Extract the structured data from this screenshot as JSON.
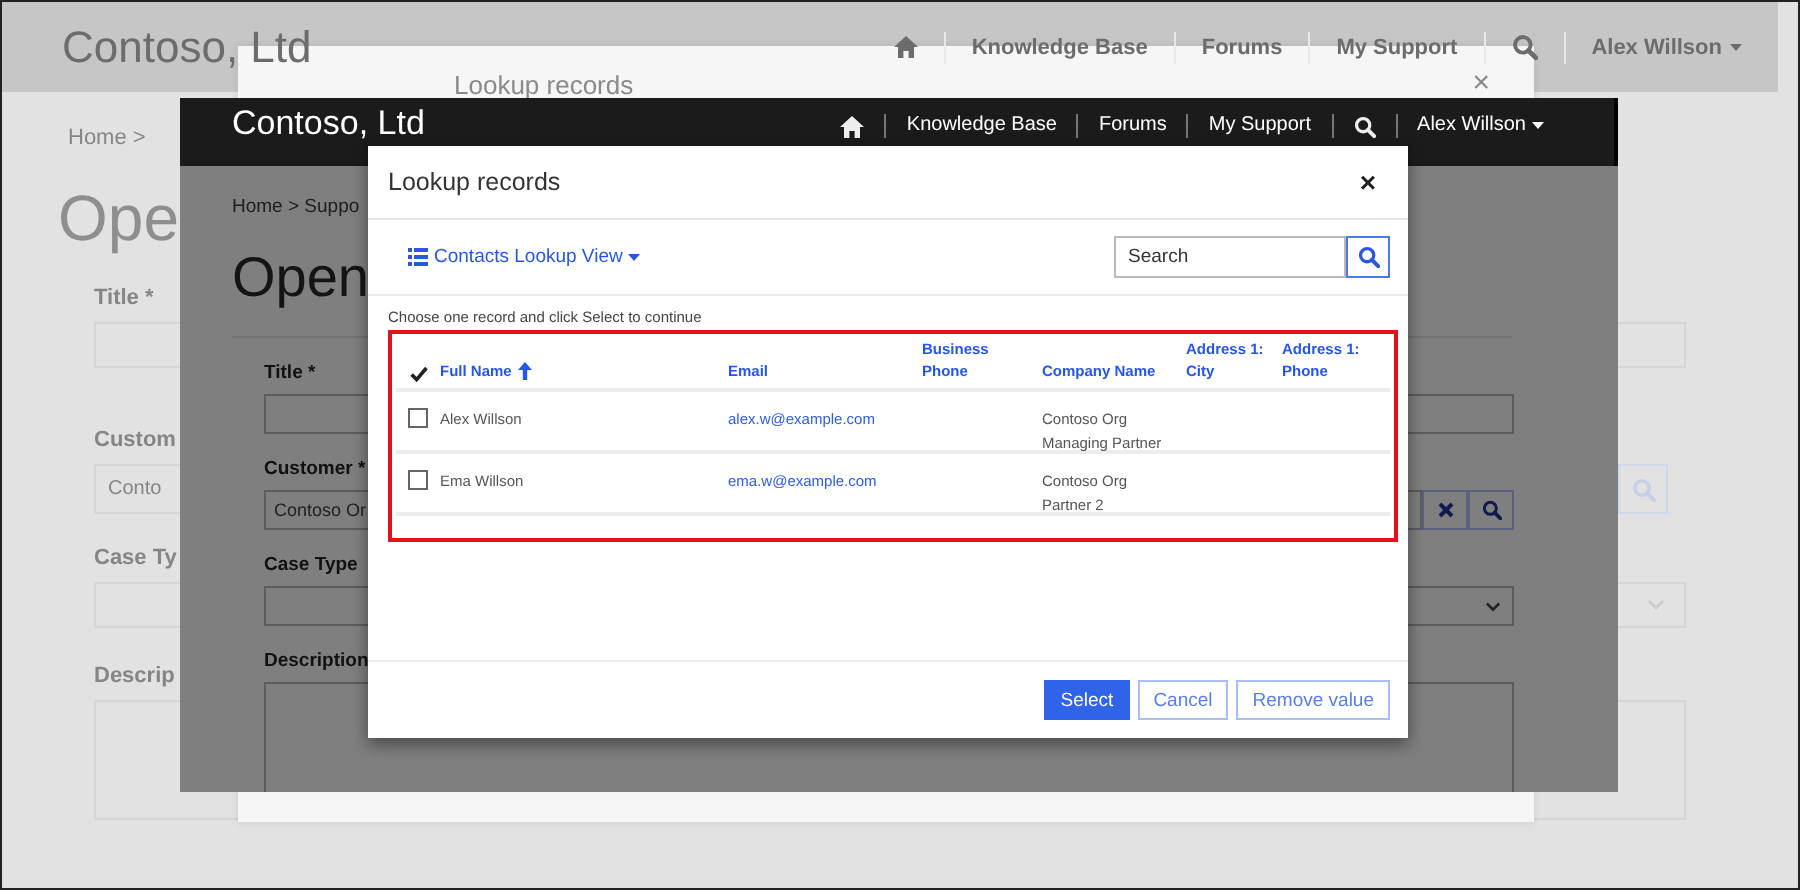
{
  "background_page": {
    "brand": "Contoso, Ltd",
    "nav_links": [
      "Knowledge Base",
      "Forums",
      "My Support"
    ],
    "user_menu": "Alex Willson",
    "dialog_title": "Lookup records",
    "dialog_close": "×",
    "breadcrumb": "Home  >",
    "heading": "Ope",
    "fields": [
      {
        "label": "Title *",
        "kind": "text"
      },
      {
        "label": "Custom",
        "kind": "lookup",
        "value": "Conto"
      },
      {
        "label": "Case Ty",
        "kind": "select"
      },
      {
        "label": "Descrip",
        "kind": "textarea"
      }
    ]
  },
  "page": {
    "brand": "Contoso, Ltd",
    "nav_links": [
      "Knowledge Base",
      "Forums",
      "My Support"
    ],
    "user_menu": "Alex Willson",
    "breadcrumb": "Home  >  Suppo",
    "heading": "Open",
    "fields": [
      {
        "label": "Title *",
        "kind": "text"
      },
      {
        "label": "Customer *",
        "kind": "lookup",
        "value": "Contoso Or"
      },
      {
        "label": "Case Type",
        "kind": "select"
      },
      {
        "label": "Description",
        "kind": "textarea"
      }
    ]
  },
  "dialog": {
    "title": "Lookup records",
    "close": "×",
    "view_selector": "Contacts Lookup View",
    "search": {
      "placeholder": "Search"
    },
    "instruction": "Choose one record and click Select to continue",
    "columns": [
      {
        "label": "Full Name",
        "sorted": true
      },
      {
        "label": "Email",
        "sorted": false
      },
      {
        "label": "Business Phone",
        "sorted": false
      },
      {
        "label": "Company Name",
        "sorted": false
      },
      {
        "label": "Address 1: City",
        "sorted": false
      },
      {
        "label": "Address 1: Phone",
        "sorted": false
      }
    ],
    "rows": [
      {
        "selected": false,
        "full_name": "Alex Willson",
        "email": "alex.w@example.com",
        "company_name": [
          "Contoso Org",
          "Managing Partner"
        ]
      },
      {
        "selected": false,
        "full_name": "Ema Willson",
        "email": "ema.w@example.com",
        "company_name": [
          "Contoso Org",
          "Partner 2"
        ]
      }
    ],
    "buttons": [
      {
        "label": "Select",
        "kind": "primary"
      },
      {
        "label": "Cancel",
        "kind": "secondary"
      },
      {
        "label": "Remove value",
        "kind": "secondary"
      }
    ]
  }
}
